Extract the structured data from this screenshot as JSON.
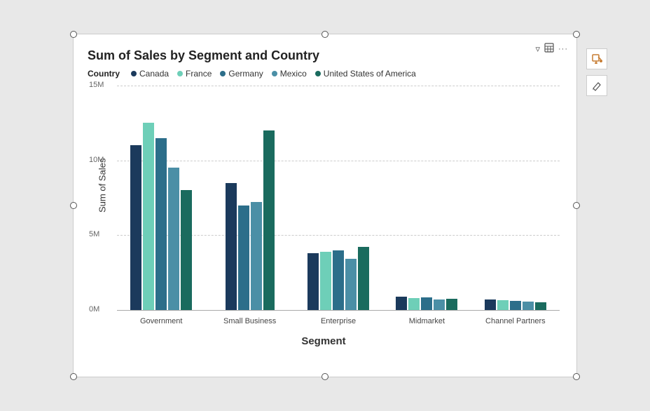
{
  "title": "Sum of Sales by Segment and Country",
  "legend": {
    "label": "Country",
    "items": [
      {
        "name": "Canada",
        "color": "#1b3a5c"
      },
      {
        "name": "France",
        "color": "#6ecfb8"
      },
      {
        "name": "Germany",
        "color": "#2c6e8a"
      },
      {
        "name": "Mexico",
        "color": "#4b8fa6"
      },
      {
        "name": "United States of America",
        "color": "#1a6b5e"
      }
    ]
  },
  "yAxis": {
    "label": "Sum of Sales",
    "ticks": [
      "15M",
      "10M",
      "5M",
      "0M"
    ]
  },
  "xAxis": {
    "label": "Segment"
  },
  "segments": [
    {
      "name": "Government",
      "bars": [
        {
          "country": "Canada",
          "value": 11,
          "color": "#1b3a5c"
        },
        {
          "country": "France",
          "value": 12.5,
          "color": "#6ecfb8"
        },
        {
          "country": "Germany",
          "value": 11.5,
          "color": "#2c6e8a"
        },
        {
          "country": "Mexico",
          "value": 9.5,
          "color": "#4b8fa6"
        },
        {
          "country": "United States of America",
          "value": 8,
          "color": "#1a6b5e"
        }
      ]
    },
    {
      "name": "Small Business",
      "bars": [
        {
          "country": "Canada",
          "value": 8.5,
          "color": "#1b3a5c"
        },
        {
          "country": "France",
          "value": 0,
          "color": "#6ecfb8"
        },
        {
          "country": "Germany",
          "value": 7,
          "color": "#2c6e8a"
        },
        {
          "country": "Mexico",
          "value": 7.2,
          "color": "#4b8fa6"
        },
        {
          "country": "United States of America",
          "value": 12,
          "color": "#1a6b5e"
        }
      ]
    },
    {
      "name": "Enterprise",
      "bars": [
        {
          "country": "Canada",
          "value": 3.8,
          "color": "#1b3a5c"
        },
        {
          "country": "France",
          "value": 3.9,
          "color": "#6ecfb8"
        },
        {
          "country": "Germany",
          "value": 4.0,
          "color": "#2c6e8a"
        },
        {
          "country": "Mexico",
          "value": 3.4,
          "color": "#4b8fa6"
        },
        {
          "country": "United States of America",
          "value": 4.2,
          "color": "#1a6b5e"
        }
      ]
    },
    {
      "name": "Midmarket",
      "bars": [
        {
          "country": "Canada",
          "value": 0.9,
          "color": "#1b3a5c"
        },
        {
          "country": "France",
          "value": 0.8,
          "color": "#6ecfb8"
        },
        {
          "country": "Germany",
          "value": 0.85,
          "color": "#2c6e8a"
        },
        {
          "country": "Mexico",
          "value": 0.7,
          "color": "#4b8fa6"
        },
        {
          "country": "United States of America",
          "value": 0.75,
          "color": "#1a6b5e"
        }
      ]
    },
    {
      "name": "Channel Partners",
      "bars": [
        {
          "country": "Canada",
          "value": 0.7,
          "color": "#1b3a5c"
        },
        {
          "country": "France",
          "value": 0.65,
          "color": "#6ecfb8"
        },
        {
          "country": "Germany",
          "value": 0.6,
          "color": "#2c6e8a"
        },
        {
          "country": "Mexico",
          "value": 0.55,
          "color": "#4b8fa6"
        },
        {
          "country": "United States of America",
          "value": 0.5,
          "color": "#1a6b5e"
        }
      ]
    }
  ],
  "toolbar": {
    "filter_icon": "▽",
    "table_icon": "▦",
    "more_icon": "···"
  },
  "side_icons": {
    "paint_icon": "🎨",
    "cursor_icon": "✎"
  }
}
